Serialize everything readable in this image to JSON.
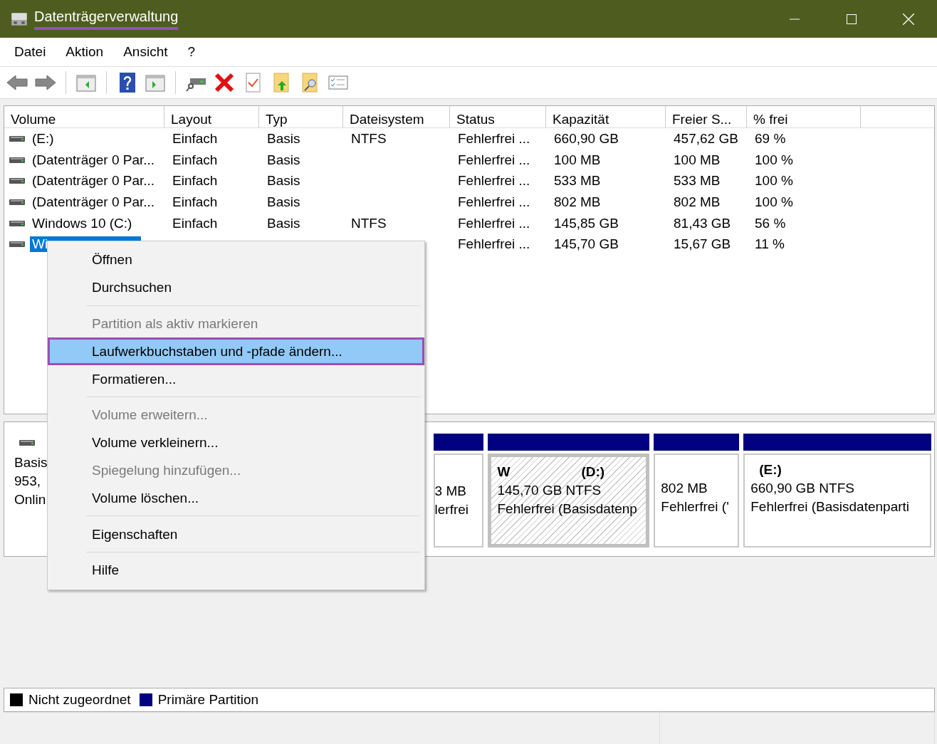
{
  "window": {
    "title": "Datenträgerverwaltung"
  },
  "menu_bar": [
    "Datei",
    "Aktion",
    "Ansicht",
    "?"
  ],
  "volume_list": {
    "columns": [
      "Volume",
      "Layout",
      "Typ",
      "Dateisystem",
      "Status",
      "Kapazität",
      "Freier S...",
      "% frei"
    ],
    "rows": [
      {
        "selected": false,
        "cells": [
          "(E:)",
          "Einfach",
          "Basis",
          "NTFS",
          "Fehlerfrei ...",
          "660,90 GB",
          "457,62 GB",
          "69 %"
        ]
      },
      {
        "selected": false,
        "cells": [
          "(Datenträger 0 Par...",
          "Einfach",
          "Basis",
          null,
          "Fehlerfrei ...",
          "100 MB",
          "100 MB",
          "100 %"
        ]
      },
      {
        "selected": false,
        "cells": [
          "(Datenträger 0 Par...",
          "Einfach",
          "Basis",
          null,
          "Fehlerfrei ...",
          "533 MB",
          "533 MB",
          "100 %"
        ]
      },
      {
        "selected": false,
        "cells": [
          "(Datenträger 0 Par...",
          "Einfach",
          "Basis",
          null,
          "Fehlerfrei ...",
          "802 MB",
          "802 MB",
          "100 %"
        ]
      },
      {
        "selected": false,
        "cells": [
          "Windows 10 (C:)",
          "Einfach",
          "Basis",
          "NTFS",
          "Fehlerfrei ...",
          "145,85 GB",
          "81,43 GB",
          "56 %"
        ]
      },
      {
        "selected": true,
        "cells": [
          "Wi",
          null,
          null,
          null,
          "Fehlerfrei ...",
          "145,70 GB",
          "15,67 GB",
          "11 %"
        ]
      }
    ]
  },
  "disk": {
    "info": [
      "Basis",
      "953,",
      "Onlin"
    ],
    "partitions": [
      {
        "selected": false,
        "partial": true,
        "size": "3 MB",
        "status": "lerfrei"
      },
      {
        "selected": true,
        "partial": false,
        "name": "W",
        "letter": "(D:)",
        "size": "145,70 GB NTFS",
        "status": "Fehlerfrei (Basisdatenp"
      },
      {
        "selected": false,
        "partial": false,
        "size": "802 MB",
        "status": "Fehlerfrei ('"
      },
      {
        "selected": false,
        "partial": false,
        "letter": "(E:)",
        "size": "660,90 GB NTFS",
        "status": "Fehlerfrei (Basisdatenparti"
      }
    ]
  },
  "legend": [
    {
      "label": "Nicht zugeordnet",
      "color": "#000000"
    },
    {
      "label": "Primäre Partition",
      "color": "#000080"
    }
  ],
  "context_menu": [
    {
      "kind": "item",
      "label": "Öffnen",
      "disabled": false,
      "selected": false
    },
    {
      "kind": "item",
      "label": "Durchsuchen",
      "disabled": false,
      "selected": false
    },
    {
      "kind": "separator"
    },
    {
      "kind": "item",
      "label": "Partition als aktiv markieren",
      "disabled": true,
      "selected": false
    },
    {
      "kind": "item",
      "label": "Laufwerkbuchstaben und -pfade ändern...",
      "disabled": false,
      "selected": true
    },
    {
      "kind": "item",
      "label": "Formatieren...",
      "disabled": false,
      "selected": false
    },
    {
      "kind": "separator"
    },
    {
      "kind": "item",
      "label": "Volume erweitern...",
      "disabled": true,
      "selected": false
    },
    {
      "kind": "item",
      "label": "Volume verkleinern...",
      "disabled": false,
      "selected": false
    },
    {
      "kind": "item",
      "label": "Spiegelung hinzufügen...",
      "disabled": true,
      "selected": false
    },
    {
      "kind": "item",
      "label": "Volume löschen...",
      "disabled": false,
      "selected": false
    },
    {
      "kind": "separator"
    },
    {
      "kind": "item",
      "label": "Eigenschaften",
      "disabled": false,
      "selected": false
    },
    {
      "kind": "separator"
    },
    {
      "kind": "item",
      "label": "Hilfe",
      "disabled": false,
      "selected": false
    }
  ]
}
